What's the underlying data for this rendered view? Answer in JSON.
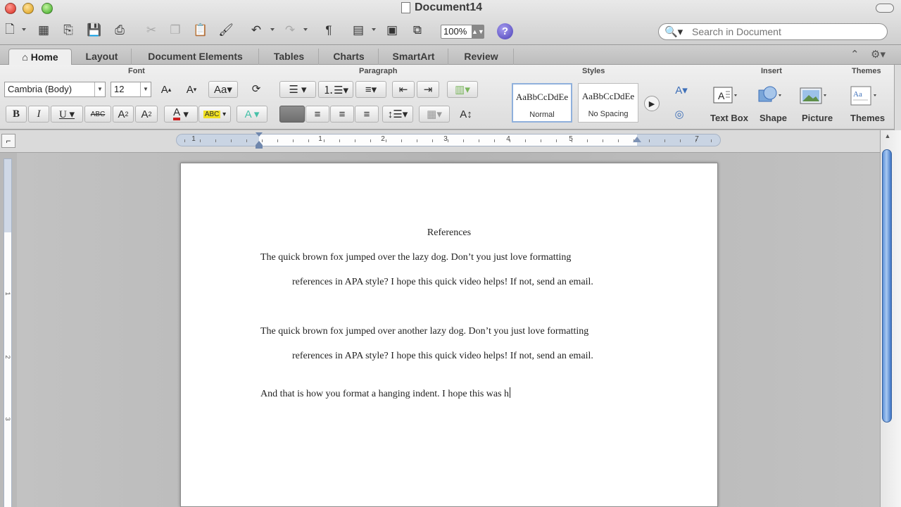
{
  "window": {
    "title": "Document14"
  },
  "toolbar": {
    "zoom": "100%",
    "search_placeholder": "Search in Document"
  },
  "ribbon_tabs": [
    "Home",
    "Layout",
    "Document Elements",
    "Tables",
    "Charts",
    "SmartArt",
    "Review"
  ],
  "ribbon": {
    "font_group_label": "Font",
    "paragraph_group_label": "Paragraph",
    "styles_group_label": "Styles",
    "insert_group_label": "Insert",
    "themes_group_label": "Themes",
    "font_name": "Cambria (Body)",
    "font_size": "12",
    "styles": [
      {
        "sample": "AaBbCcDdEe",
        "name": "Normal"
      },
      {
        "sample": "AaBbCcDdEe",
        "name": "No Spacing"
      }
    ],
    "insert_items": [
      "Text Box",
      "Shape",
      "Picture"
    ],
    "themes_label": "Themes",
    "themes_sample": "Aa"
  },
  "ruler": {
    "numbers": [
      "1",
      "1",
      "2",
      "3",
      "4",
      "5",
      "7"
    ]
  },
  "vruler": {
    "numbers": [
      "1",
      "2",
      "3"
    ]
  },
  "document": {
    "heading": "References",
    "paragraphs": [
      "The quick brown fox jumped over the lazy dog.  Don’t you just love formatting",
      "references in APA style?  I hope this quick video helps! If not, send an email.",
      "The quick brown fox jumped over another lazy dog.  Don’t you just love formatting",
      "references in APA style?  I hope this quick video helps! If not, send an email.",
      "And that is how you format a hanging indent. I hope this was h"
    ]
  },
  "colors": {
    "accent": "#5b8fd8",
    "font_color": "#cc2222",
    "highlight": "#f0e020"
  }
}
